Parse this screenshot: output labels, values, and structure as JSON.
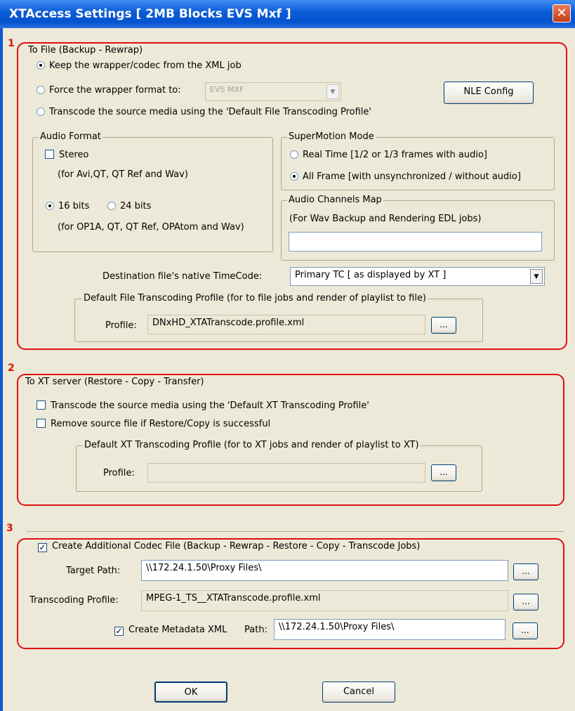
{
  "window": {
    "title": "XTAccess Settings [ 2MB Blocks EVS Mxf ]",
    "close_glyph": "✕"
  },
  "sections": {
    "one": "1",
    "two": "2",
    "three": "3"
  },
  "to_file": {
    "legend": "To File (Backup - Rewrap)",
    "keep_wrapper": "Keep the wrapper/codec from the XML job",
    "force_wrapper": "Force the wrapper format to:",
    "force_wrapper_value": "EVS MXF",
    "transcode": "Transcode the source media using the 'Default File Transcoding Profile'",
    "nle_button": "NLE Config",
    "audio_format": {
      "legend": "Audio Format",
      "stereo": "Stereo",
      "stereo_note": "(for Avi,QT, QT Ref and Wav)",
      "bits16": "16 bits",
      "bits24": "24 bits",
      "bits_note": "(for OP1A, QT, QT Ref, OPAtom and Wav)"
    },
    "supermotion": {
      "legend": "SuperMotion Mode",
      "realtime": "Real Time [1/2 or 1/3 frames with audio]",
      "allframe": "All Frame [with unsynchronized / without audio]"
    },
    "audio_map": {
      "legend": "Audio Channels Map",
      "note": "(For Wav Backup and Rendering EDL jobs)",
      "value": ""
    },
    "timecode_label": "Destination file's native TimeCode:",
    "timecode_value": "Primary TC [ as displayed by XT ]",
    "profile_group": {
      "legend": "Default File Transcoding Profile (for to file jobs and render of playlist to file)",
      "label": "Profile:",
      "value": "DNxHD_XTATranscode.profile.xml",
      "browse": "..."
    }
  },
  "to_xt": {
    "legend": "To XT server (Restore - Copy - Transfer)",
    "transcode": "Transcode the source media using the 'Default XT Transcoding Profile'",
    "remove_source": "Remove source file if Restore/Copy is successful",
    "profile_group": {
      "legend": "Default XT Transcoding Profile (for to XT jobs and render of playlist to XT)",
      "label": "Profile:",
      "value": "",
      "browse": "..."
    }
  },
  "codec": {
    "legend": "Create Additional Codec File (Backup - Rewrap - Restore - Copy - Transcode Jobs)",
    "target_label": "Target Path:",
    "target_value": "\\\\172.24.1.50\\Proxy Files\\",
    "profile_label": "Transcoding Profile:",
    "profile_value": "MPEG-1_TS__XTATranscode.profile.xml",
    "metadata_label": "Create Metadata XML",
    "path_label": "Path:",
    "path_value": "\\\\172.24.1.50\\Proxy Files\\",
    "browse": "..."
  },
  "buttons": {
    "ok": "OK",
    "cancel": "Cancel"
  },
  "glyphs": {
    "check": "✓",
    "dropdown": "▼"
  }
}
